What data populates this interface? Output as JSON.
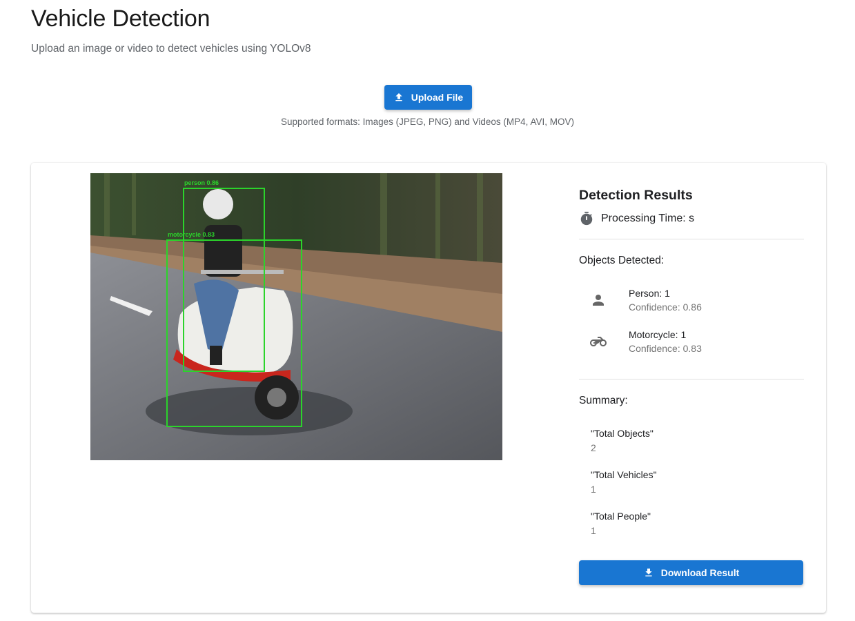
{
  "header": {
    "title": "Vehicle Detection",
    "subtitle": "Upload an image or video to detect vehicles using YOLOv8"
  },
  "upload": {
    "button_label": "Upload File",
    "icon": "upload-icon",
    "formats_note": "Supported formats: Images (JPEG, PNG) and Videos (MP4, AVI, MOV)"
  },
  "result_image": {
    "description_icon": "annotated-detection-image",
    "boxes": [
      {
        "label": "person 0.86"
      },
      {
        "label": "motorcycle 0.83"
      }
    ],
    "box_color": "#2bd42b"
  },
  "results": {
    "title": "Detection Results",
    "processing_time": "Processing Time: s",
    "timer_icon": "timer-icon",
    "objects_label": "Objects Detected:",
    "objects": [
      {
        "icon": "person-icon",
        "name": "Person: 1",
        "confidence": "Confidence: 0.86"
      },
      {
        "icon": "motorcycle-icon",
        "name": "Motorcycle: 1",
        "confidence": "Confidence: 0.83"
      }
    ],
    "summary_label": "Summary:",
    "summary": [
      {
        "key": "\"Total Objects\"",
        "value": "2"
      },
      {
        "key": "\"Total Vehicles\"",
        "value": "1"
      },
      {
        "key": "\"Total People\"",
        "value": "1"
      }
    ],
    "download_label": "Download Result",
    "download_icon": "download-icon"
  },
  "colors": {
    "primary": "#1976d2",
    "text": "#202124",
    "secondary_text": "#757575"
  }
}
